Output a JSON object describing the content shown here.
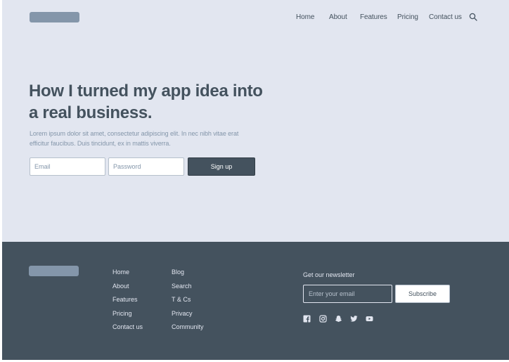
{
  "header": {
    "nav": [
      "Home",
      "About",
      "Features",
      "Pricing",
      "Contact us"
    ],
    "search_icon": "search-icon"
  },
  "hero": {
    "title_line1": "How I turned my app idea into",
    "title_line2": "a real business.",
    "subtitle_line1": "Lorem ipsum dolor sit amet, consectetur adipiscing elit. In nec nibh vitae erat",
    "subtitle_line2": "efficitur faucibus. Duis tincidunt, ex in mattis viverra.",
    "email_placeholder": "Email",
    "password_placeholder": "Password",
    "signup_label": "Sign up"
  },
  "footer": {
    "col1": [
      "Home",
      "About",
      "Features",
      "Pricing",
      "Contact us"
    ],
    "col2": [
      "Blog",
      "Search",
      "T & Cs",
      "Privacy",
      "Community"
    ],
    "newsletter_title": "Get our newsletter",
    "newsletter_placeholder": "Enter your email",
    "subscribe_label": "Subscribe",
    "social_icons": [
      "facebook-icon",
      "instagram-icon",
      "snapchat-icon",
      "twitter-icon",
      "youtube-icon"
    ]
  },
  "colors": {
    "hero_bg": "#e2e6f0",
    "footer_bg": "#44525e",
    "text_dark": "#44525e",
    "text_muted": "#8496aa",
    "logo": "#8496aa"
  }
}
